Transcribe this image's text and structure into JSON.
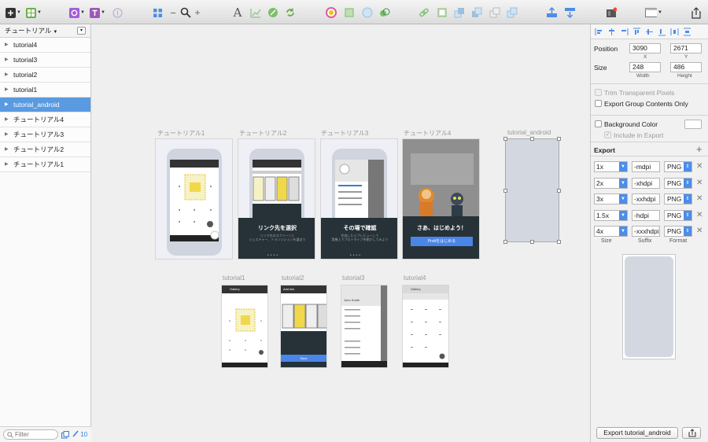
{
  "left_panel": {
    "page_name": "チュートリアル",
    "layers": [
      {
        "label": "tutorial4",
        "selected": false
      },
      {
        "label": "tutorial3",
        "selected": false
      },
      {
        "label": "tutorial2",
        "selected": false
      },
      {
        "label": "tutorial1",
        "selected": false
      },
      {
        "label": "tutorial_android",
        "selected": true
      },
      {
        "label": "チュートリアル4",
        "selected": false
      },
      {
        "label": "チュートリアル3",
        "selected": false
      },
      {
        "label": "チュートリアル2",
        "selected": false
      },
      {
        "label": "チュートリアル1",
        "selected": false
      }
    ],
    "filter_placeholder": "Filter",
    "slice_count": "10"
  },
  "canvas": {
    "artboards_top": [
      {
        "label": "チュートリアル1"
      },
      {
        "label": "チュートリアル2",
        "caption": "リンク先を選択",
        "sub": "リンク先のスクリーンと\nジェスチャー、トランジションを選ぼう"
      },
      {
        "label": "チュートリアル3",
        "caption": "その場で確認",
        "sub": "完成したらプレビューして\n実機上でプロトタイプを動かしてみよう"
      },
      {
        "label": "チュートリアル4",
        "caption": "さあ、はじめよう！",
        "button": "Prottをはじめる"
      }
    ],
    "android_label": "tutorial_android",
    "artboards_bottom": [
      {
        "label": "tutorial1",
        "bar": "Gallery"
      },
      {
        "label": "tutorial2",
        "bar": "Add link",
        "button": "Save"
      },
      {
        "label": "tutorial3",
        "bar": "John Smith"
      },
      {
        "label": "tutorial4",
        "bar": "Gallery"
      }
    ]
  },
  "inspector": {
    "position_label": "Position",
    "x": "3090",
    "y": "2671",
    "x_label": "X",
    "y_label": "Y",
    "size_label": "Size",
    "width": "248",
    "height": "486",
    "width_label": "Width",
    "height_label": "Height",
    "trim_label": "Trim Transparent Pixels",
    "export_group_label": "Export Group Contents Only",
    "bg_color_label": "Background Color",
    "include_export_label": "Include in Export",
    "export_header": "Export",
    "export_rows": [
      {
        "scale": "1x",
        "suffix": "-mdpi",
        "format": "PNG"
      },
      {
        "scale": "2x",
        "suffix": "-xhdpi",
        "format": "PNG"
      },
      {
        "scale": "3x",
        "suffix": "-xxhdpi",
        "format": "PNG"
      },
      {
        "scale": "1.5x",
        "suffix": "-hdpi",
        "format": "PNG"
      },
      {
        "scale": "4x",
        "suffix": "-xxxhdpi",
        "format": "PNG"
      }
    ],
    "col_size": "Size",
    "col_suffix": "Suffix",
    "col_format": "Format",
    "export_button": "Export tutorial_android"
  },
  "colors": {
    "selection": "#5a9ae0",
    "accent": "#4d8de8",
    "tutorial_button": "#4a86e8",
    "dark_panel": "#263238"
  }
}
